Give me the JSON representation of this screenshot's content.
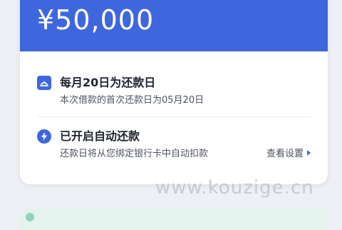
{
  "loan": {
    "amount": "¥50,000"
  },
  "repayment_date": {
    "title": "每月20日为还款日",
    "subtitle": "本次借款的首次还款日为05月20日",
    "icon": "calendar-icon"
  },
  "auto_repay": {
    "title": "已开启自动还款",
    "subtitle": "还款日将从您绑定银行卡中自动扣款",
    "link_label": "查看设置",
    "icon": "lightning-icon"
  },
  "watermark": {
    "text": "www.kouzige.cn"
  },
  "colors": {
    "accent": "#3f67dd",
    "card_bg": "#ffffff",
    "page_bg": "#eef0f5",
    "banner_bg": "#e4f3ee"
  }
}
